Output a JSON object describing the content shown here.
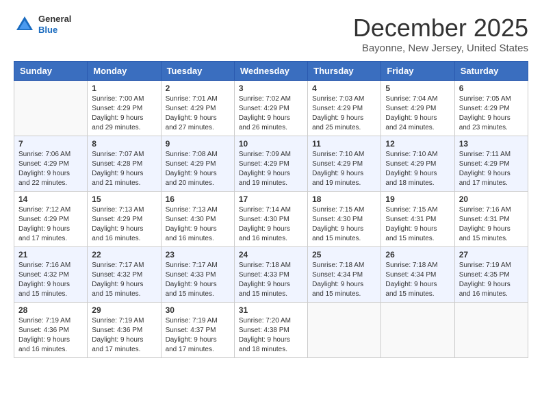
{
  "logo": {
    "general": "General",
    "blue": "Blue"
  },
  "title": "December 2025",
  "subtitle": "Bayonne, New Jersey, United States",
  "days_of_week": [
    "Sunday",
    "Monday",
    "Tuesday",
    "Wednesday",
    "Thursday",
    "Friday",
    "Saturday"
  ],
  "weeks": [
    [
      {
        "day": "",
        "info": ""
      },
      {
        "day": "1",
        "info": "Sunrise: 7:00 AM\nSunset: 4:29 PM\nDaylight: 9 hours\nand 29 minutes."
      },
      {
        "day": "2",
        "info": "Sunrise: 7:01 AM\nSunset: 4:29 PM\nDaylight: 9 hours\nand 27 minutes."
      },
      {
        "day": "3",
        "info": "Sunrise: 7:02 AM\nSunset: 4:29 PM\nDaylight: 9 hours\nand 26 minutes."
      },
      {
        "day": "4",
        "info": "Sunrise: 7:03 AM\nSunset: 4:29 PM\nDaylight: 9 hours\nand 25 minutes."
      },
      {
        "day": "5",
        "info": "Sunrise: 7:04 AM\nSunset: 4:29 PM\nDaylight: 9 hours\nand 24 minutes."
      },
      {
        "day": "6",
        "info": "Sunrise: 7:05 AM\nSunset: 4:29 PM\nDaylight: 9 hours\nand 23 minutes."
      }
    ],
    [
      {
        "day": "7",
        "info": "Sunrise: 7:06 AM\nSunset: 4:29 PM\nDaylight: 9 hours\nand 22 minutes."
      },
      {
        "day": "8",
        "info": "Sunrise: 7:07 AM\nSunset: 4:28 PM\nDaylight: 9 hours\nand 21 minutes."
      },
      {
        "day": "9",
        "info": "Sunrise: 7:08 AM\nSunset: 4:29 PM\nDaylight: 9 hours\nand 20 minutes."
      },
      {
        "day": "10",
        "info": "Sunrise: 7:09 AM\nSunset: 4:29 PM\nDaylight: 9 hours\nand 19 minutes."
      },
      {
        "day": "11",
        "info": "Sunrise: 7:10 AM\nSunset: 4:29 PM\nDaylight: 9 hours\nand 19 minutes."
      },
      {
        "day": "12",
        "info": "Sunrise: 7:10 AM\nSunset: 4:29 PM\nDaylight: 9 hours\nand 18 minutes."
      },
      {
        "day": "13",
        "info": "Sunrise: 7:11 AM\nSunset: 4:29 PM\nDaylight: 9 hours\nand 17 minutes."
      }
    ],
    [
      {
        "day": "14",
        "info": "Sunrise: 7:12 AM\nSunset: 4:29 PM\nDaylight: 9 hours\nand 17 minutes."
      },
      {
        "day": "15",
        "info": "Sunrise: 7:13 AM\nSunset: 4:29 PM\nDaylight: 9 hours\nand 16 minutes."
      },
      {
        "day": "16",
        "info": "Sunrise: 7:13 AM\nSunset: 4:30 PM\nDaylight: 9 hours\nand 16 minutes."
      },
      {
        "day": "17",
        "info": "Sunrise: 7:14 AM\nSunset: 4:30 PM\nDaylight: 9 hours\nand 16 minutes."
      },
      {
        "day": "18",
        "info": "Sunrise: 7:15 AM\nSunset: 4:30 PM\nDaylight: 9 hours\nand 15 minutes."
      },
      {
        "day": "19",
        "info": "Sunrise: 7:15 AM\nSunset: 4:31 PM\nDaylight: 9 hours\nand 15 minutes."
      },
      {
        "day": "20",
        "info": "Sunrise: 7:16 AM\nSunset: 4:31 PM\nDaylight: 9 hours\nand 15 minutes."
      }
    ],
    [
      {
        "day": "21",
        "info": "Sunrise: 7:16 AM\nSunset: 4:32 PM\nDaylight: 9 hours\nand 15 minutes."
      },
      {
        "day": "22",
        "info": "Sunrise: 7:17 AM\nSunset: 4:32 PM\nDaylight: 9 hours\nand 15 minutes."
      },
      {
        "day": "23",
        "info": "Sunrise: 7:17 AM\nSunset: 4:33 PM\nDaylight: 9 hours\nand 15 minutes."
      },
      {
        "day": "24",
        "info": "Sunrise: 7:18 AM\nSunset: 4:33 PM\nDaylight: 9 hours\nand 15 minutes."
      },
      {
        "day": "25",
        "info": "Sunrise: 7:18 AM\nSunset: 4:34 PM\nDaylight: 9 hours\nand 15 minutes."
      },
      {
        "day": "26",
        "info": "Sunrise: 7:18 AM\nSunset: 4:34 PM\nDaylight: 9 hours\nand 15 minutes."
      },
      {
        "day": "27",
        "info": "Sunrise: 7:19 AM\nSunset: 4:35 PM\nDaylight: 9 hours\nand 16 minutes."
      }
    ],
    [
      {
        "day": "28",
        "info": "Sunrise: 7:19 AM\nSunset: 4:36 PM\nDaylight: 9 hours\nand 16 minutes."
      },
      {
        "day": "29",
        "info": "Sunrise: 7:19 AM\nSunset: 4:36 PM\nDaylight: 9 hours\nand 17 minutes."
      },
      {
        "day": "30",
        "info": "Sunrise: 7:19 AM\nSunset: 4:37 PM\nDaylight: 9 hours\nand 17 minutes."
      },
      {
        "day": "31",
        "info": "Sunrise: 7:20 AM\nSunset: 4:38 PM\nDaylight: 9 hours\nand 18 minutes."
      },
      {
        "day": "",
        "info": ""
      },
      {
        "day": "",
        "info": ""
      },
      {
        "day": "",
        "info": ""
      }
    ]
  ]
}
